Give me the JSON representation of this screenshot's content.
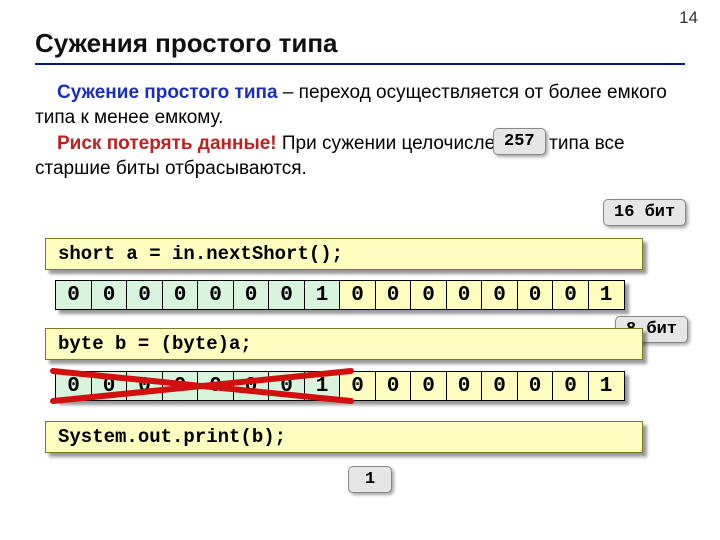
{
  "page_number": "14",
  "title": "Сужения простого типа",
  "paragraph": {
    "term1": "Сужение простого типа",
    "text1": " – переход осуществляется от более емкого типа к менее емкому.",
    "term2": "Риск потерять данные!",
    "text2": " При сужении целочисленного типа все старшие биты отбрасываются."
  },
  "tags": {
    "value_in": "257",
    "bits_hi": "16 бит",
    "bits_lo": "8 бит",
    "value_out": "1"
  },
  "code": {
    "line1": "short a = in.nextShort();",
    "line2": "byte b = (byte)a;",
    "line3": "System.out.print(b);"
  },
  "bits": {
    "hi": [
      "0",
      "0",
      "0",
      "0",
      "0",
      "0",
      "0",
      "1"
    ],
    "lo": [
      "0",
      "0",
      "0",
      "0",
      "0",
      "0",
      "0",
      "1"
    ]
  }
}
